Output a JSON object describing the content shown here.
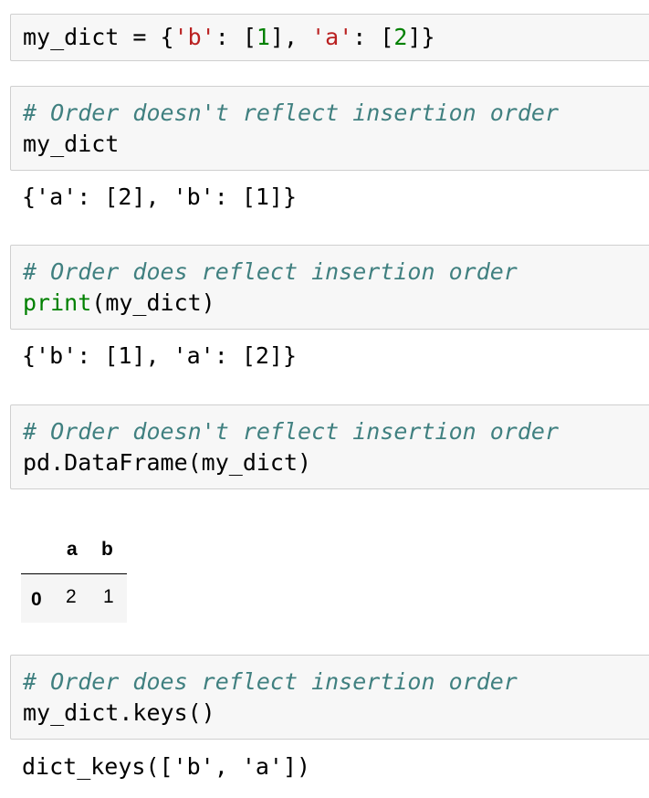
{
  "cells": [
    {
      "input": {
        "prefix": "my_dict = {",
        "s1": "'b'",
        "sep1": ": [",
        "n1": "1",
        "sep2": "], ",
        "s2": "'a'",
        "sep3": ": [",
        "n2": "2",
        "suffix": "]}"
      }
    },
    {
      "comment": "# Order doesn't reflect insertion order",
      "code": "my_dict",
      "output": "{'a': [2], 'b': [1]}"
    },
    {
      "comment": "# Order does reflect insertion order",
      "builtin": "print",
      "code_rest": "(my_dict)",
      "output": "{'b': [1], 'a': [2]}"
    },
    {
      "comment": "# Order doesn't reflect insertion order",
      "code": "pd.DataFrame(my_dict)"
    },
    {
      "comment": "# Order does reflect insertion order",
      "code": "my_dict.keys()",
      "output": "dict_keys(['b', 'a'])"
    }
  ],
  "dataframe": {
    "columns": [
      "a",
      "b"
    ],
    "rows": [
      {
        "index": "0",
        "values": [
          "2",
          "1"
        ]
      }
    ]
  },
  "colors": {
    "comment": "#408080",
    "string": "#ba2121",
    "number": "#008000",
    "builtin": "#008000"
  }
}
